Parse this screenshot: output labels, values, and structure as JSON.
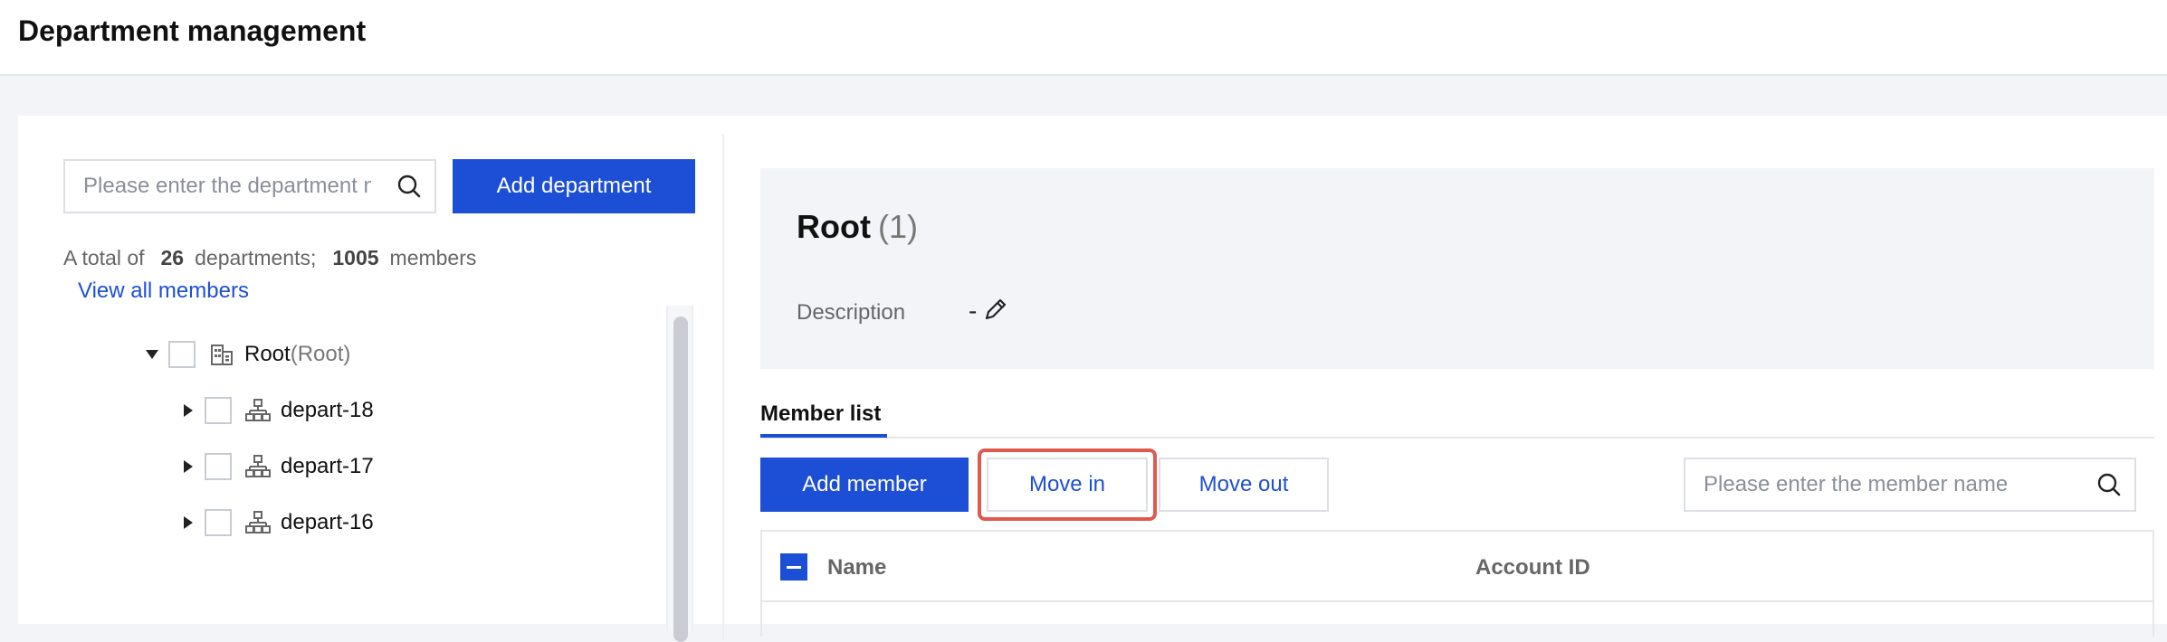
{
  "header": {
    "title": "Department management"
  },
  "left": {
    "search_placeholder": "Please enter the department name",
    "add_department": "Add department",
    "summary": {
      "prefix": "A total of",
      "departments_count": "26",
      "departments_word": "departments;",
      "members_count": "1005",
      "members_word": "members"
    },
    "view_all": "View all members",
    "tree": [
      {
        "label": "Root",
        "sub": "(Root)",
        "expanded": true,
        "icon": "building-icon"
      },
      {
        "label": "depart-18",
        "icon": "org-chart-icon"
      },
      {
        "label": "depart-17",
        "icon": "org-chart-icon"
      },
      {
        "label": "depart-16",
        "icon": "org-chart-icon"
      }
    ]
  },
  "right": {
    "title": "Root",
    "count": "(1)",
    "description_label": "Description",
    "description_value": "-",
    "tab": "Member list",
    "add_member": "Add member",
    "move_in": "Move in",
    "move_out": "Move out",
    "member_search_placeholder": "Please enter the member name",
    "columns": {
      "name": "Name",
      "account_id": "Account ID"
    }
  },
  "colors": {
    "primary": "#1d4fd6",
    "highlight": "#e0594f",
    "panel_bg": "#f3f4f7"
  }
}
